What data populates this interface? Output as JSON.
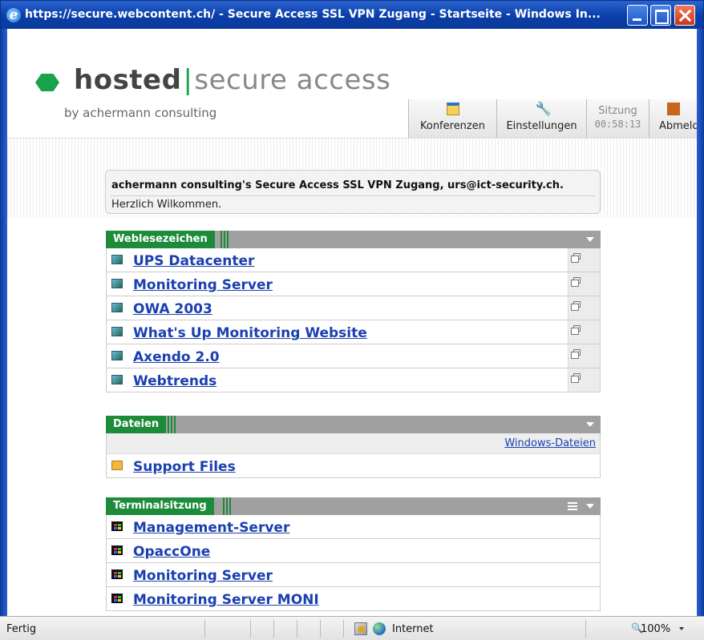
{
  "window": {
    "title": "https://secure.webcontent.ch/ - Secure Access SSL VPN Zugang - Startseite - Windows In..."
  },
  "header": {
    "logo_word1": "hosted",
    "logo_word2": "secure access",
    "logo_sub": "by achermann consulting",
    "nav": {
      "konferenzen": "Konferenzen",
      "einstellungen": "Einstellungen",
      "sitzung_label": "Sitzung",
      "sitzung_time": "00:58:13",
      "abmelden": "Abmeld"
    }
  },
  "welcome": {
    "line1": "achermann consulting's Secure Access SSL VPN Zugang, urs@ict-security.ch.",
    "line2": "Herzlich Wilkommen."
  },
  "bookmarks": {
    "title": "Weblesezeichen",
    "items": [
      {
        "label": "UPS Datacenter"
      },
      {
        "label": "Monitoring Server"
      },
      {
        "label": "OWA 2003"
      },
      {
        "label": "What's Up Monitoring Website"
      },
      {
        "label": "Axendo 2.0"
      },
      {
        "label": "Webtrends"
      }
    ]
  },
  "files": {
    "title": "Dateien",
    "windows_link": "Windows-Dateien",
    "items": [
      {
        "label": "Support Files"
      }
    ]
  },
  "terminal": {
    "title": "Terminalsitzung",
    "items": [
      {
        "label": "Management-Server"
      },
      {
        "label": "OpaccOne"
      },
      {
        "label": "Monitoring Server"
      },
      {
        "label": "Monitoring Server MONI"
      }
    ]
  },
  "statusbar": {
    "status": "Fertig",
    "zone": "Internet",
    "zoom": "100%"
  },
  "colors": {
    "panel_header": "#1c8c3a",
    "link": "#1a3fb0",
    "titlebar": "#0a3ea8"
  }
}
